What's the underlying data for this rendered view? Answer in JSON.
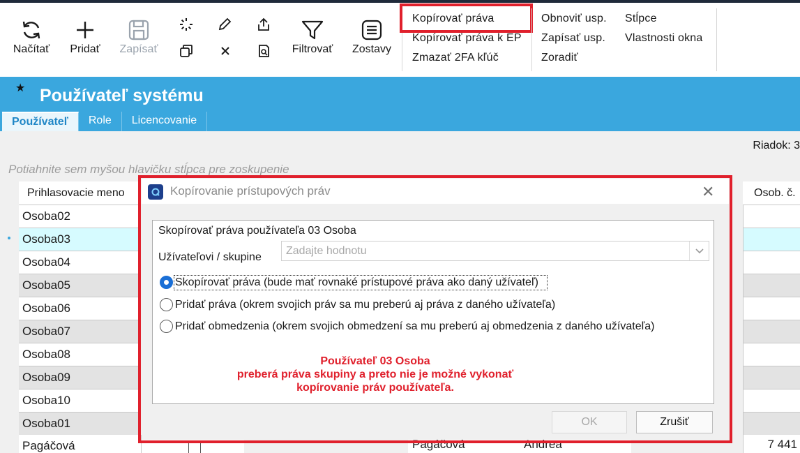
{
  "ribbon": {
    "buttons": [
      {
        "label": "Načítať",
        "icon": "refresh-icon"
      },
      {
        "label": "Pridať",
        "icon": "plus-icon"
      },
      {
        "label": "Zapísať",
        "icon": "save-icon"
      },
      {
        "label": "Filtrovať",
        "icon": "filter-icon"
      },
      {
        "label": "Zostavy",
        "icon": "reports-icon"
      }
    ],
    "small_icons": [
      "loading-icon",
      "edit-icon",
      "export-icon",
      "copy-icon",
      "delete-icon",
      "search-document-icon"
    ],
    "menu_col1": [
      "Kopírovať práva",
      "Kopírovať práva k EP",
      "Zmazať 2FA kľúč"
    ],
    "menu_col2": [
      "Obnoviť usp.",
      "Zapísať usp.",
      "Zoradiť"
    ],
    "menu_col3": [
      "Stĺpce",
      "Vlastnosti okna"
    ]
  },
  "header": {
    "title": "Používateľ systému",
    "tabs": [
      "Používateľ",
      "Role",
      "Licencovanie"
    ]
  },
  "grid": {
    "row_counter": "Riadok: 3",
    "group_hint": "Potiahnite sem myšou hlavičku stĺpca pre zoskupenie",
    "col_login": "Prihlasovacie meno",
    "col_osob": "Osob. č.",
    "rows": [
      "Osoba02",
      "Osoba03",
      "Osoba04",
      "Osoba05",
      "Osoba06",
      "Osoba07",
      "Osoba08",
      "Osoba09",
      "Osoba10",
      "Osoba01"
    ],
    "last_row": {
      "login": "Pagáčová",
      "c1": "Pagáčová",
      "c2": "Andrea",
      "osob": "7 441"
    }
  },
  "dialog": {
    "title": "Kopírovanie prístupových práv",
    "group_label": "Skopírovať práva používateľa 03 Osoba",
    "target_label": "Užívateľovi / skupine",
    "target_placeholder": "Zadajte hodnotu",
    "options": [
      "Skopírovať práva (bude mať rovnaké prístupové práva ako daný užívateľ)",
      "Pridať práva (okrem svojich práv sa mu preberú aj práva z daného užívateľa)",
      "Pridať obmedzenia (okrem svojich obmedzení sa mu preberú aj obmedzenia z daného užívateľa)"
    ],
    "note": [
      "Používateľ 03 Osoba",
      "preberá práva skupiny a preto nie je možné vykonať",
      "kopírovanie práv používateľa."
    ],
    "ok": "OK",
    "cancel": "Zrušiť"
  },
  "colors": {
    "accent": "#3aa7de",
    "highlight": "#e0202c",
    "selected_row": "#d6fbff"
  }
}
